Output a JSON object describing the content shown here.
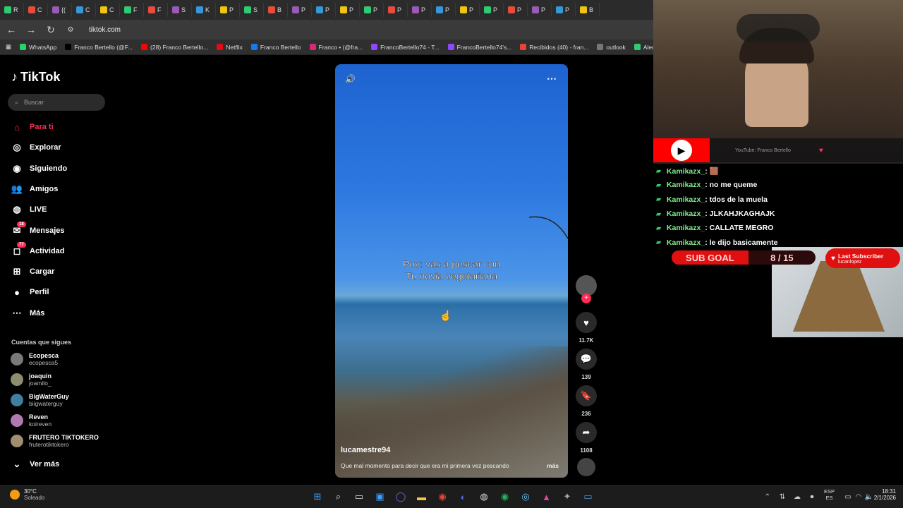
{
  "browser": {
    "tabs": [
      "R",
      "C",
      "{(",
      "C",
      "C",
      "F",
      "F",
      "S",
      "K",
      "P",
      "S",
      "B",
      "P",
      "P",
      "P",
      "P",
      "P",
      "P",
      "P",
      "P",
      "P",
      "P",
      "P",
      "P",
      "B"
    ],
    "url": "tiktok.com",
    "bookmarks": [
      {
        "label": "WhatsApp",
        "color": "#25d366"
      },
      {
        "label": "Franco Bertello (@F...",
        "color": "#000000"
      },
      {
        "label": "(28) Franco Bertello...",
        "color": "#ff0000"
      },
      {
        "label": "Netflix",
        "color": "#e50914"
      },
      {
        "label": "Franco Bertello",
        "color": "#1877f2"
      },
      {
        "label": "Franco • (@fra...",
        "color": "#d62976"
      },
      {
        "label": "FrancoBertello74 - T...",
        "color": "#9146ff"
      },
      {
        "label": "FrancoBertello74's...",
        "color": "#9146ff"
      },
      {
        "label": "Recibidos (40) - fran...",
        "color": "#ea4335"
      },
      {
        "label": "outlook",
        "color": "#777777"
      },
      {
        "label": "Aler",
        "color": "#2ecc71"
      }
    ]
  },
  "tiktok": {
    "logo": "TikTok",
    "search_placeholder": "Buscar",
    "nav": [
      {
        "label": "Para ti",
        "active": true
      },
      {
        "label": "Explorar"
      },
      {
        "label": "Siguiendo"
      },
      {
        "label": "Amigos"
      },
      {
        "label": "LIVE"
      },
      {
        "label": "Mensajes",
        "badge": "18"
      },
      {
        "label": "Actividad",
        "badge": "77"
      },
      {
        "label": "Cargar"
      },
      {
        "label": "Perfil"
      },
      {
        "label": "Más"
      }
    ],
    "following_title": "Cuentas que sigues",
    "following": [
      {
        "name": "Ecopesca",
        "handle": "ecopesca5"
      },
      {
        "name": "joaquin",
        "handle": "joamilo_"
      },
      {
        "name": "BigWaterGuy",
        "handle": "biigwaterguy"
      },
      {
        "name": "Reven",
        "handle": "koireven"
      },
      {
        "name": "FRUTERO TIKTOKERO",
        "handle": "fruterotiktokero"
      }
    ],
    "see_more": "Ver más",
    "video": {
      "caption_line1": "Pov: vas a pescar con",
      "caption_line2": "Tu novia vegetariana",
      "user": "lucamestre94",
      "description": "Que mal momento para decir que era mi primera vez pescando",
      "more": "más",
      "likes": "11.7K",
      "comments": "139",
      "saves": "236",
      "shares": "1108"
    }
  },
  "taskbar": {
    "weather_temp": "30°C",
    "weather_desc": "Soleado",
    "lang1": "ESP",
    "lang2": "ES",
    "time": "18:31",
    "date": "2/1/2026"
  },
  "stream": {
    "yt_label": "YouTube: Franco Bertello",
    "chat": [
      {
        "user": "Kamikazx_",
        "msg": ": 🟫"
      },
      {
        "user": "Kamikazx_",
        "msg": ": no me queme"
      },
      {
        "user": "Kamikazx_",
        "msg": ": tdos de la muela"
      },
      {
        "user": "Kamikazx_",
        "msg": ": JLKAHJKAGHAJK"
      },
      {
        "user": "Kamikazx_",
        "msg": ": CALLATE MEGRO"
      },
      {
        "user": "Kamikazx_",
        "msg": ": le dijo basicamente"
      }
    ],
    "sub_goal_label": "SUB GOAL",
    "sub_goal_count": "8 / 15",
    "sub_goal_progress": 0.533,
    "last_sub_title": "Last Subscriber",
    "last_sub_name": "lucanlopez"
  }
}
